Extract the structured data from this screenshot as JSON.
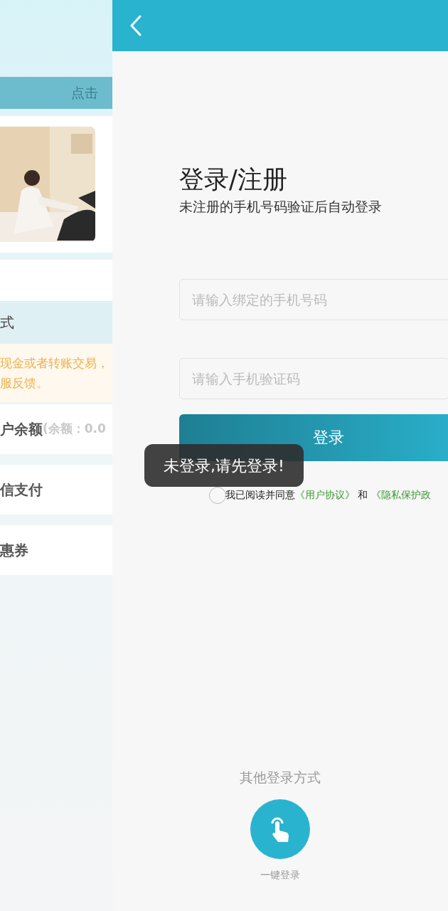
{
  "background_page": {
    "banner": "点击",
    "section_title": "式",
    "notice_lines": [
      "现金或者转账交易，",
      "服反馈。"
    ],
    "payment_rows": [
      {
        "label": "户余额",
        "note": "(余额：0.0"
      },
      {
        "label": "信支付"
      },
      {
        "label": "惠券"
      }
    ]
  },
  "login_panel": {
    "title": "登录/注册",
    "subtitle": "未注册的手机号码验证后自动登录",
    "fields": [
      {
        "placeholder": "请输入绑定的手机号码"
      },
      {
        "placeholder": "请输入手机验证码"
      }
    ],
    "login_button": "登录",
    "agreement": {
      "checked": false,
      "text": "我已阅读并同意",
      "links": [
        "《用户协议》",
        "《隐私保护政"
      ],
      "joiner": "和"
    },
    "other_methods": {
      "label": "其他登录方式",
      "methods": [
        {
          "label": "一键登录"
        }
      ]
    }
  },
  "toast": "未登录,请先登录!"
}
